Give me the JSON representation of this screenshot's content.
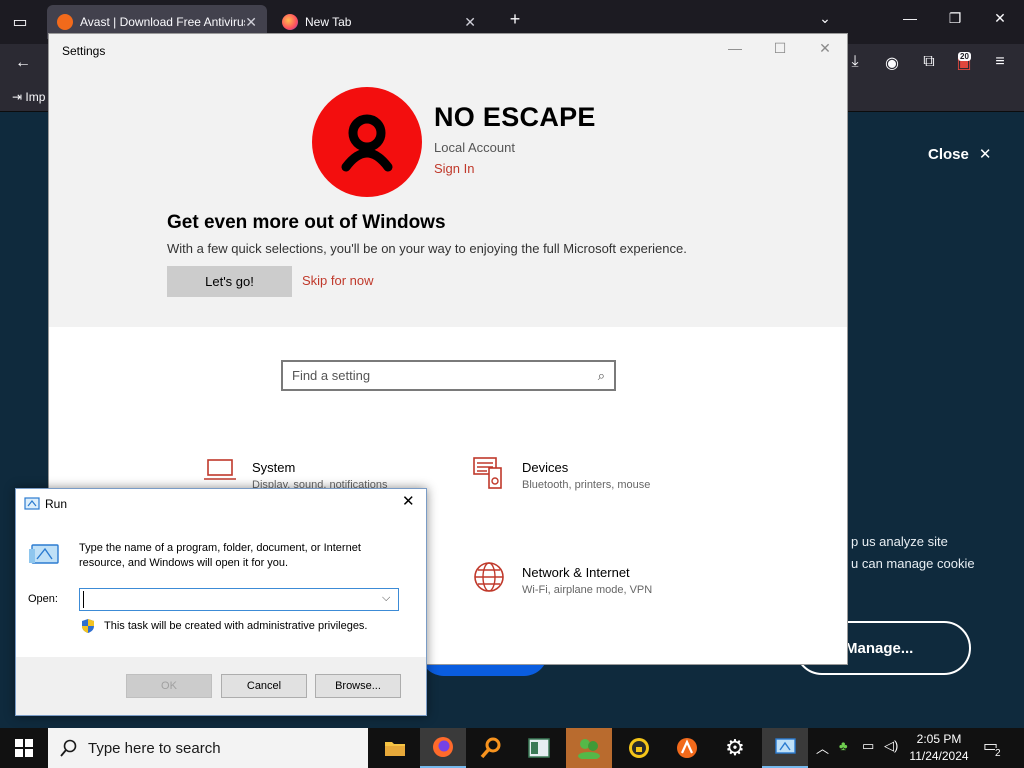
{
  "browser": {
    "tabs": [
      {
        "title": "Avast | Download Free Antivirus",
        "active": true
      },
      {
        "title": "New Tab",
        "active": false
      }
    ],
    "new_tab_symbol": "+",
    "extensions_badge": "20",
    "bookmark_label": "Imp"
  },
  "page": {
    "close_label": "Close",
    "cookie_line1": "p us analyze site",
    "cookie_line2": "u can manage cookie",
    "manage_label": "Manage..."
  },
  "settings": {
    "title": "Settings",
    "user_name": "NO ESCAPE",
    "account_type": "Local Account",
    "sign_in": "Sign In",
    "promo_title": "Get even more out of Windows",
    "promo_text": "With a few quick selections, you'll be on your way to enjoying the full Microsoft experience.",
    "lets_go": "Let's go!",
    "skip": "Skip for now",
    "search_placeholder": "Find a setting",
    "categories": [
      {
        "name": "System",
        "desc": "Display, sound, notifications"
      },
      {
        "name": "Devices",
        "desc": "Bluetooth, printers, mouse"
      },
      {
        "name": "Network & Internet",
        "desc": "Wi-Fi, airplane mode, VPN"
      }
    ]
  },
  "run": {
    "title": "Run",
    "description": "Type the name of a program, folder, document, or Internet resource, and Windows will open it for you.",
    "open_label": "Open:",
    "open_value": "",
    "admin_note": "This task will be created with administrative privileges.",
    "ok": "OK",
    "cancel": "Cancel",
    "browse": "Browse..."
  },
  "taskbar": {
    "search_placeholder": "Type here to search",
    "time": "2:05 PM",
    "date": "11/24/2024",
    "notification_count": "2"
  },
  "colors": {
    "accent_red": "#f30e0e",
    "link_red": "#c0392b",
    "page_bg": "#0f2a3d"
  }
}
